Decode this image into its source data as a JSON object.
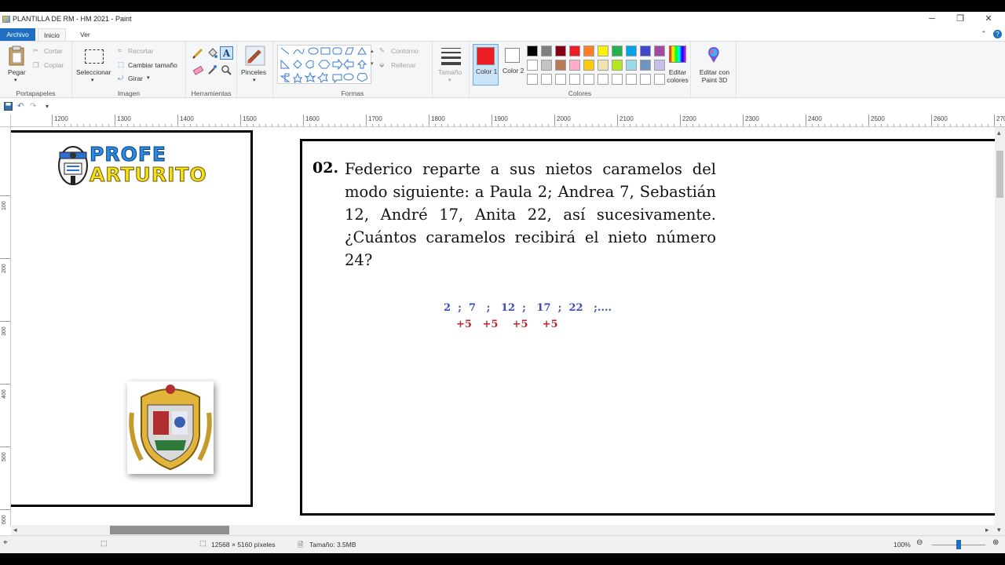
{
  "window": {
    "title": "PLANTILLA DE RM - HM 2021 - Paint",
    "minimize": "─",
    "maximize": "❐",
    "close": "✕"
  },
  "tabs": [
    {
      "label": "Archivo"
    },
    {
      "label": "Inicio"
    },
    {
      "label": "Ver"
    }
  ],
  "ribbon": {
    "clipboard": {
      "paste": "Pegar",
      "cut": "Cortar",
      "copy": "Copiar",
      "group": "Portapapeles"
    },
    "image": {
      "select": "Seleccionar",
      "crop": "Recortar",
      "resize": "Cambiar tamaño",
      "rotate": "Girar",
      "group": "Imagen"
    },
    "tools": {
      "group": "Herramientas"
    },
    "brushes": {
      "label": "Pinceles"
    },
    "shapes": {
      "outline": "Contorno",
      "fill": "Rellenar",
      "group": "Formas"
    },
    "size": {
      "label": "Tamaño"
    },
    "colors": {
      "color1": "Color 1",
      "color2": "Color 2",
      "color1_value": "#ed1c24",
      "color2_value": "#ffffff",
      "edit": "Editar colores",
      "group": "Colores",
      "palette_row1": [
        "#000000",
        "#7f7f7f",
        "#880015",
        "#ed1c24",
        "#ff7f27",
        "#fff200",
        "#22b14c",
        "#00a2e8",
        "#3f48cc",
        "#a349a4"
      ],
      "palette_row2": [
        "#ffffff",
        "#c3c3c3",
        "#b97a57",
        "#ffaec9",
        "#ffc90e",
        "#efe4b0",
        "#b5e61d",
        "#99d9ea",
        "#7092be",
        "#c8bfe7"
      ],
      "palette_row3": [
        "#ffffff",
        "#ffffff",
        "#ffffff",
        "#ffffff",
        "#ffffff",
        "#ffffff",
        "#ffffff",
        "#ffffff",
        "#ffffff",
        "#ffffff"
      ]
    },
    "paint3d": {
      "label": "Editar con Paint 3D"
    }
  },
  "ruler": {
    "horizontal": [
      "1200",
      "1300",
      "1400",
      "1500",
      "1600",
      "1700",
      "1800",
      "1900",
      "2000",
      "2100",
      "2200",
      "2300",
      "2400",
      "2500",
      "2600",
      "270"
    ],
    "vertical": [
      "100",
      "200",
      "300",
      "400",
      "500",
      "600"
    ]
  },
  "canvas": {
    "logo_line1": "PROFE",
    "logo_line2": "ARTURITO",
    "problem_number": "02.",
    "problem_text": "Federico reparte a sus nietos caramelos del modo siguiente: a Paula 2; Andrea 7, Sebastián 12, André 17, Anita 22, así sucesivamente. ¿Cuántos caramelos recibirá el nieto número 24?",
    "sequence": "2  ;  7   ;   12  ;   17  ;  22   ;....",
    "differences": "+5   +5    +5    +5"
  },
  "status": {
    "dimensions": "12568 × 5160 píxeles",
    "size": "Tamaño: 3.5MB",
    "zoom": "100%"
  }
}
